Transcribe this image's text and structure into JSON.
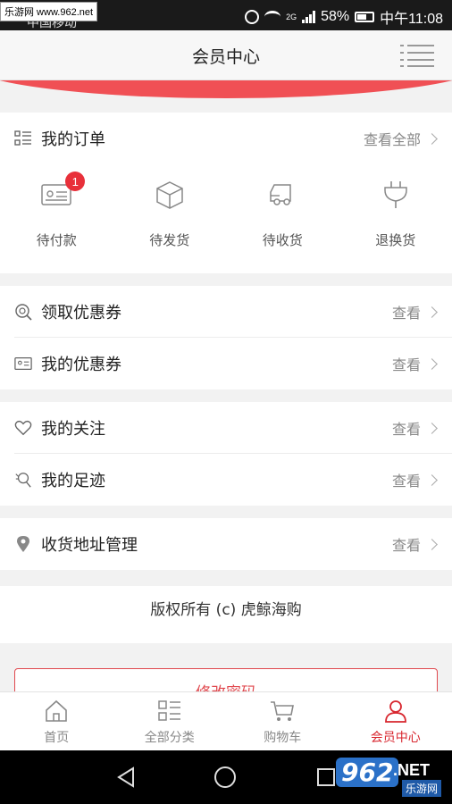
{
  "status_bar": {
    "watermark": "乐游网 www.962.net",
    "carrier": "中国移动",
    "network": "2G",
    "battery": "58%",
    "time": "中午11:08"
  },
  "header": {
    "title": "会员中心",
    "menu_icon": "menu-icon"
  },
  "orders": {
    "title": "我的订单",
    "view_all": "查看全部",
    "items": [
      {
        "label": "待付款",
        "icon": "wallet-card-icon",
        "badge": "1"
      },
      {
        "label": "待发货",
        "icon": "box-icon"
      },
      {
        "label": "待收货",
        "icon": "truck-icon"
      },
      {
        "label": "退换货",
        "icon": "plug-icon"
      }
    ]
  },
  "coupons": {
    "get": {
      "label": "领取优惠券",
      "more": "查看",
      "icon": "coupon-search-icon"
    },
    "mine": {
      "label": "我的优惠券",
      "more": "查看",
      "icon": "coupon-card-icon"
    }
  },
  "activity": {
    "follow": {
      "label": "我的关注",
      "more": "查看",
      "icon": "heart-icon"
    },
    "footprint": {
      "label": "我的足迹",
      "more": "查看",
      "icon": "footprint-icon"
    }
  },
  "address": {
    "label": "收货地址管理",
    "more": "查看",
    "icon": "location-pin-icon"
  },
  "copyright": "版权所有 (c) 虎鲸海购",
  "password_button": "修改密码",
  "tabs": [
    {
      "label": "首页",
      "icon": "home-icon",
      "active": false
    },
    {
      "label": "全部分类",
      "icon": "category-icon",
      "active": false
    },
    {
      "label": "购物车",
      "icon": "cart-icon",
      "active": false
    },
    {
      "label": "会员中心",
      "icon": "user-icon",
      "active": true
    }
  ],
  "watermark_logo": {
    "number": "962",
    "suffix": ".NET",
    "sub": "乐游网"
  },
  "colors": {
    "accent": "#d8272f",
    "band": "#f05055",
    "badge": "#e8303a"
  }
}
